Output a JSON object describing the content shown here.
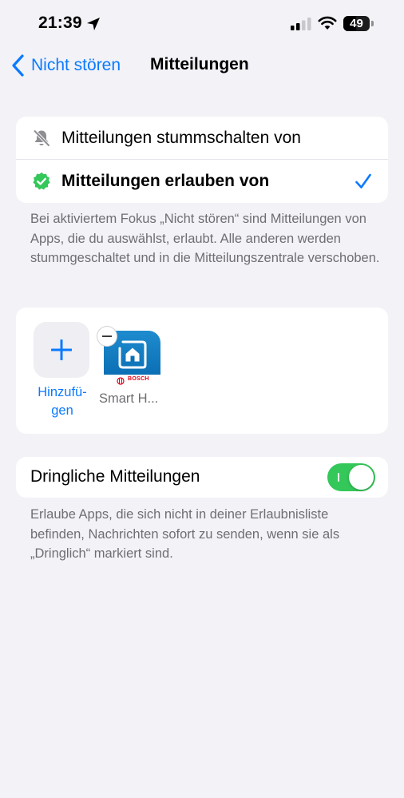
{
  "status_bar": {
    "time": "21:39",
    "battery_level": "49",
    "icons": [
      "location-arrow-icon",
      "cellular-signal-icon",
      "wifi-icon",
      "battery-icon"
    ]
  },
  "nav": {
    "back_label": "Nicht stören",
    "title": "Mitteilungen"
  },
  "mode_options": [
    {
      "label": "Mitteilungen stummschalten von",
      "icon": "bell-slash-icon",
      "selected": false
    },
    {
      "label": "Mitteilungen erlauben von",
      "icon": "verified-check-icon",
      "selected": true
    }
  ],
  "mode_footnote": "Bei aktiviertem Fokus „Nicht stören“ sind Mitteilungen von Apps, die du auswählst, erlaubt. Alle anderen werden stummgeschaltet und in die Mitteilungszentrale verschoben.",
  "apps": {
    "add_label_line1": "Hinzufü-",
    "add_label_line2": "gen",
    "items": [
      {
        "name": "Smart H...",
        "brand_text": "BOSCH",
        "icon": "bosch-smart-home-app-icon"
      }
    ]
  },
  "urgent": {
    "label": "Dringliche Mitteilungen",
    "enabled": true
  },
  "urgent_footnote": "Erlaube Apps, die sich nicht in deiner Erlaubnisliste befinden, Nachrichten sofort zu senden, wenn sie als „Dringlich“ markiert sind.",
  "colors": {
    "accent": "#0a7aff",
    "toggle_on": "#34c759",
    "background": "#f2f2f7",
    "verified_green": "#34c759",
    "bosch_red": "#e20015"
  }
}
